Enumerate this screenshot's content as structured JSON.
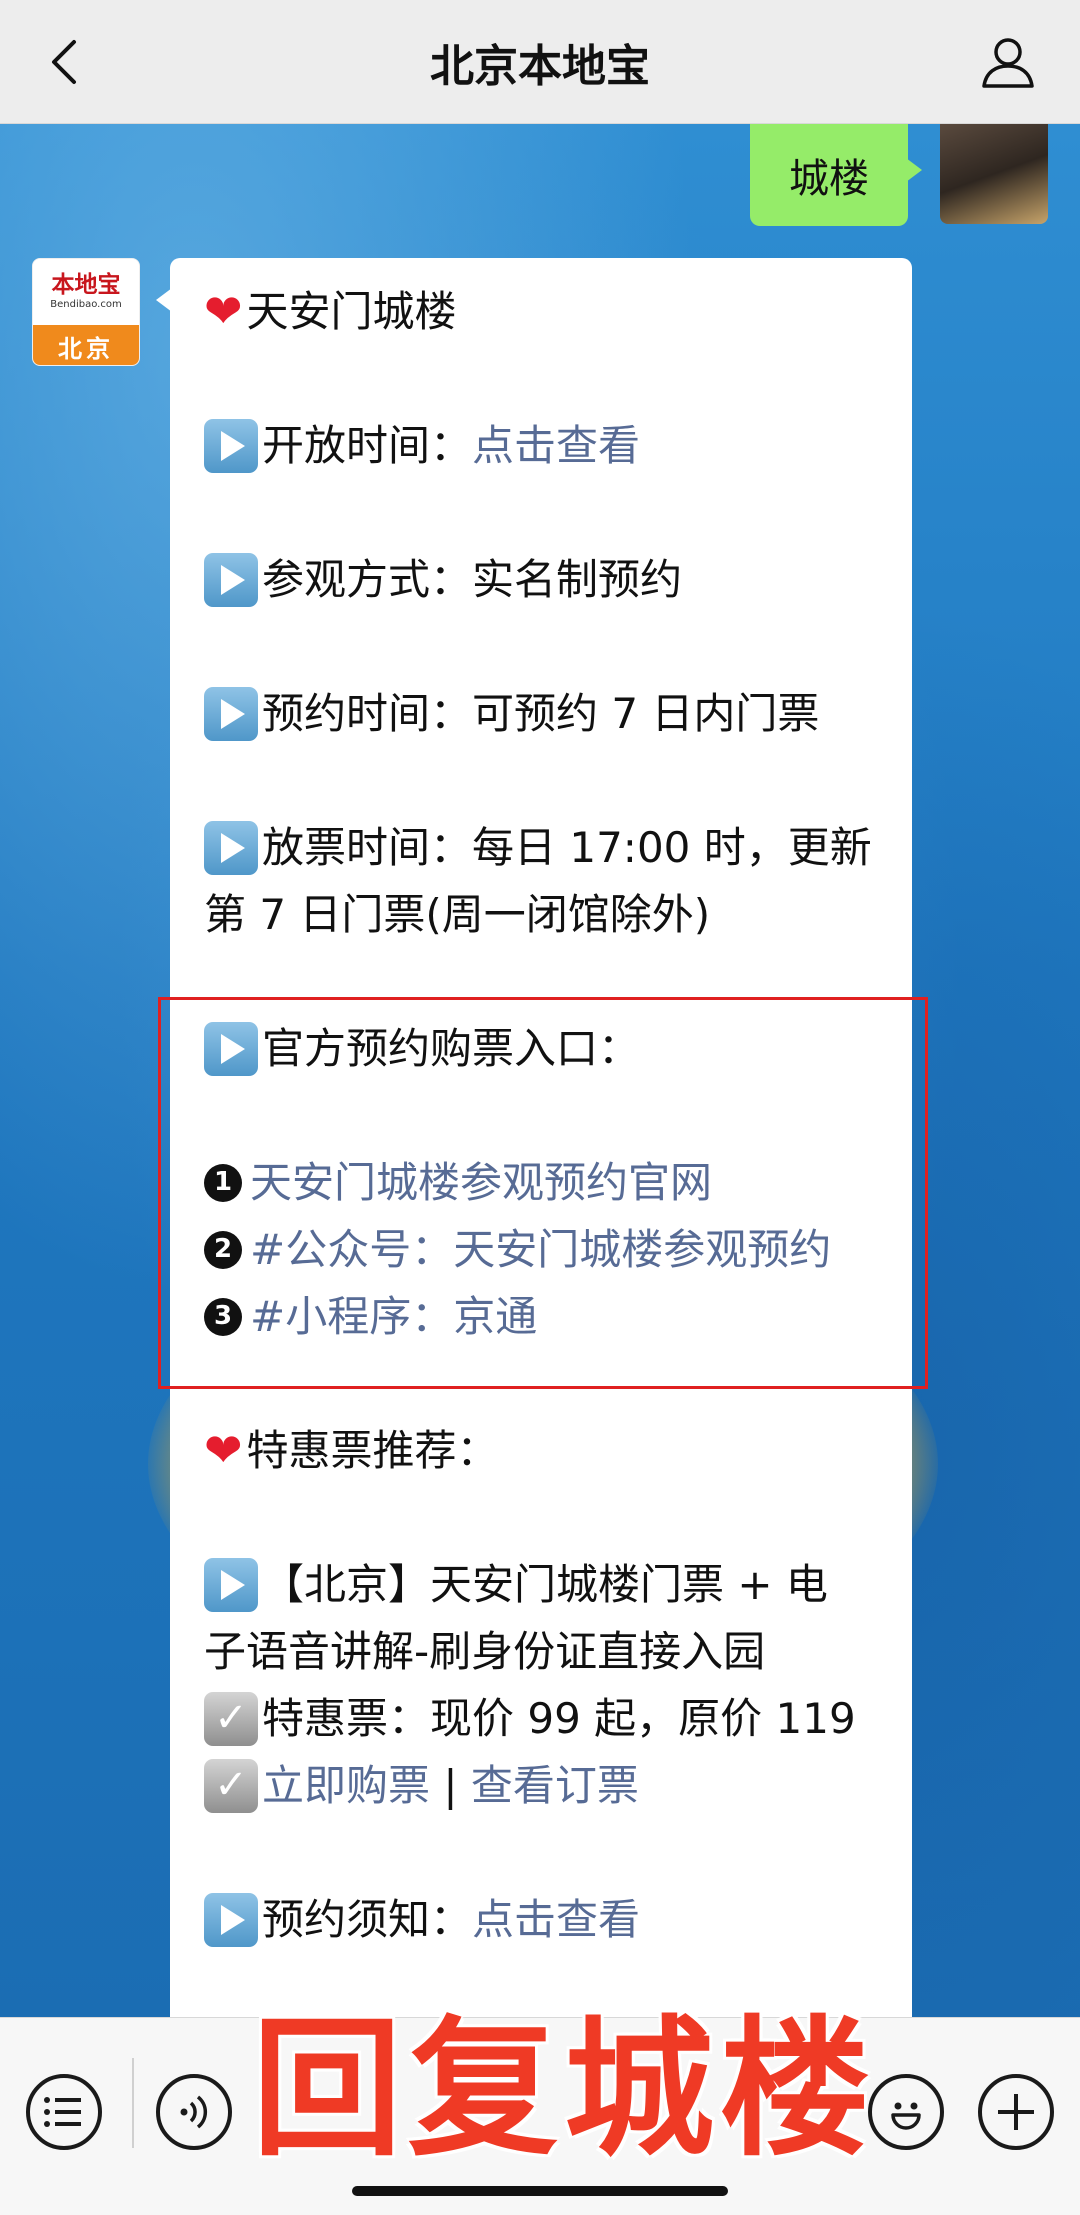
{
  "header": {
    "title": "北京本地宝"
  },
  "sent": {
    "text": "城楼"
  },
  "bot": {
    "brand": "本地宝",
    "domain": "Bendibao.com",
    "city": "北京"
  },
  "message": {
    "title": "天安门城楼",
    "open_time_label": "开放时间：",
    "open_time_link": "点击查看",
    "visit_method": "参观方式：实名制预约",
    "reserve_time": "预约时间：可预约 7 日内门票",
    "release_time_1": "放票时间：每日 17:00 时，更新",
    "release_time_2": "第 7 日门票(周一闭馆除外)",
    "official_entry": "官方预约购票入口：",
    "entry_1_num": "1",
    "entry_1": "天安门城楼参观预约官网",
    "entry_2_num": "2",
    "entry_2": "#公众号：天安门城楼参观预约",
    "entry_3_num": "3",
    "entry_3": "#小程序：京通",
    "discount_title": "特惠票推荐：",
    "product_1": "【北京】天安门城楼门票 + 电",
    "product_2": "子语音讲解-刷身份证直接入园",
    "price": "特惠票：现价 99 起，原价 119",
    "buy_link": "立即购票",
    "separator": " | ",
    "order_link": "查看订票",
    "notice_label": "预约须知：",
    "notice_link": "点击查看"
  },
  "overlay": {
    "text": "回复城楼"
  }
}
